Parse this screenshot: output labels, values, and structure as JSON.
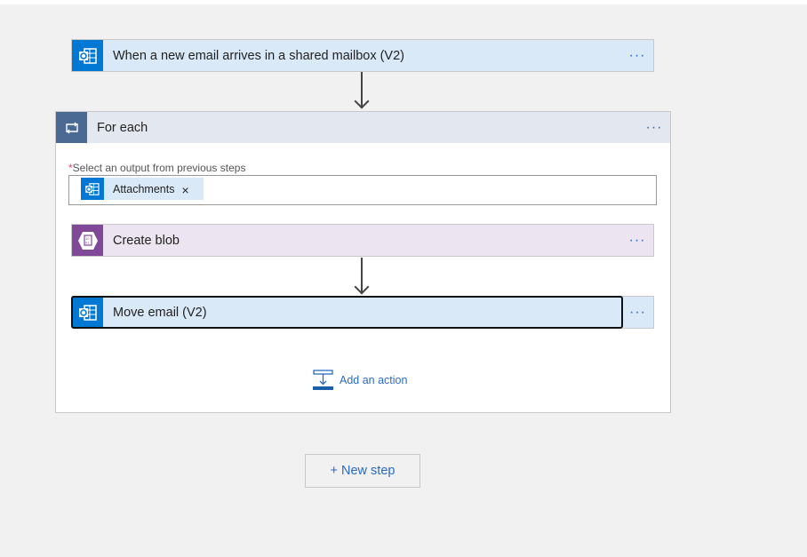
{
  "trigger": {
    "title": "When a new email arrives in a shared mailbox (V2)",
    "icon": "outlook-icon",
    "color": "#0078d4",
    "bg": "#d9e9f7"
  },
  "foreach": {
    "title": "For each",
    "icon": "loop-icon",
    "color": "#4a6a94",
    "field_label": "Select an output from previous steps",
    "required_mark": "*",
    "token": {
      "label": "Attachments",
      "remove": "×"
    }
  },
  "actions": [
    {
      "title": "Create blob",
      "icon": "blob-storage-icon",
      "color": "#804998",
      "bg": "#ece4f0"
    },
    {
      "title": "Move email (V2)",
      "icon": "outlook-icon",
      "color": "#0078d4",
      "bg": "#d9e9f7"
    }
  ],
  "more_label": "···",
  "add_action": "Add an action",
  "new_step": "+ New step"
}
